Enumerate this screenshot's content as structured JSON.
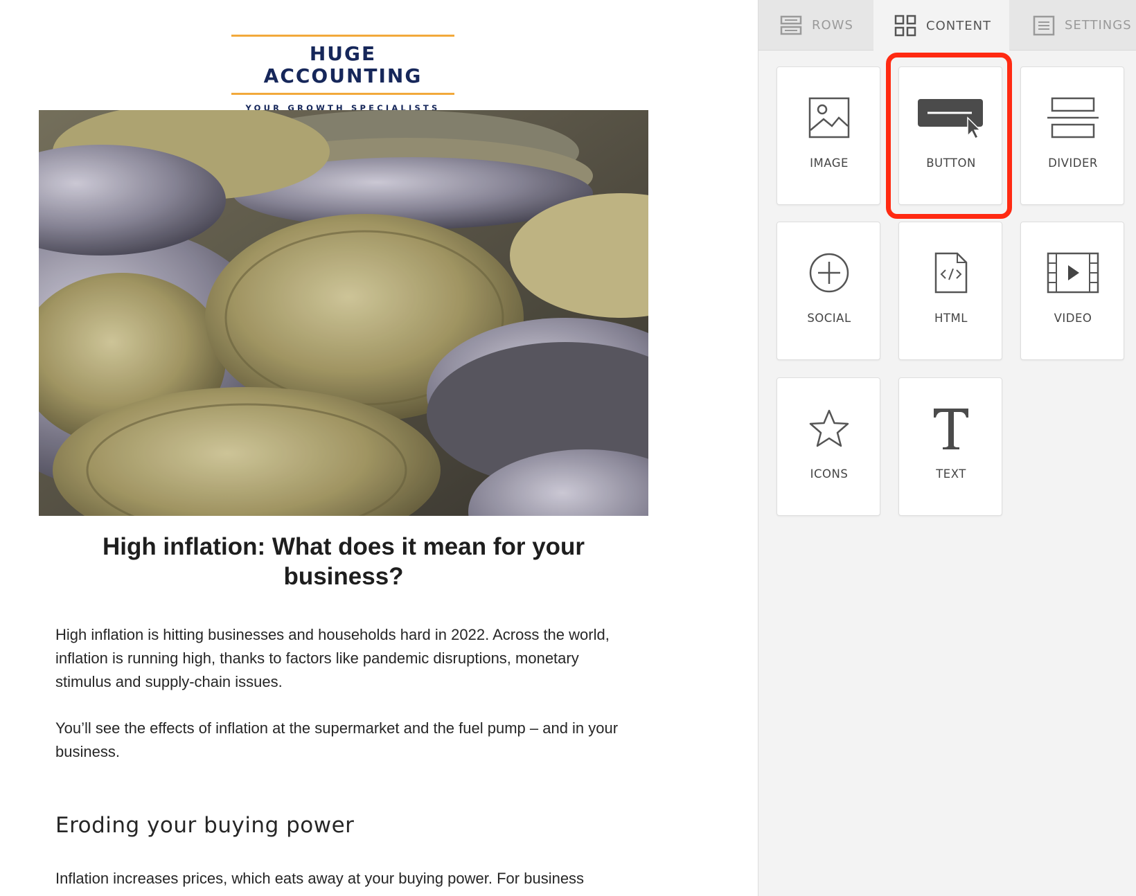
{
  "email": {
    "logo": {
      "brand": "HUGE ACCOUNTING",
      "tagline": "YOUR GROWTH SPECIALISTS",
      "brand_color": "#16275a",
      "accent_color": "#f2a93b"
    },
    "headline": "High inflation: What does it mean for your business?",
    "paragraphs": [
      "High inflation is hitting businesses and households hard in 2022. Across the world, inflation is running high, thanks to factors like pandemic disruptions, monetary stimulus and supply-chain issues.",
      "You’ll see the effects of inflation at the supermarket and the fuel pump – and in your business.",
      "Inflation increases prices, which eats away at your buying power. For business"
    ],
    "subheading": "Eroding your buying power"
  },
  "sidebar": {
    "tabs": [
      {
        "label": "ROWS",
        "icon": "rows-icon",
        "active": false
      },
      {
        "label": "CONTENT",
        "icon": "grid-icon",
        "active": true
      },
      {
        "label": "SETTINGS",
        "icon": "settings-icon",
        "active": false
      }
    ],
    "blocks": [
      {
        "label": "IMAGE",
        "icon": "image-icon"
      },
      {
        "label": "BUTTON",
        "icon": "button-icon",
        "highlighted": true
      },
      {
        "label": "DIVIDER",
        "icon": "divider-icon"
      },
      {
        "label": "SOCIAL",
        "icon": "social-plus-icon"
      },
      {
        "label": "HTML",
        "icon": "html-file-icon"
      },
      {
        "label": "VIDEO",
        "icon": "video-film-icon"
      },
      {
        "label": "ICONS",
        "icon": "star-icon"
      },
      {
        "label": "TEXT",
        "icon": "text-t-icon"
      }
    ],
    "highlight_color": "#ff2a12"
  }
}
